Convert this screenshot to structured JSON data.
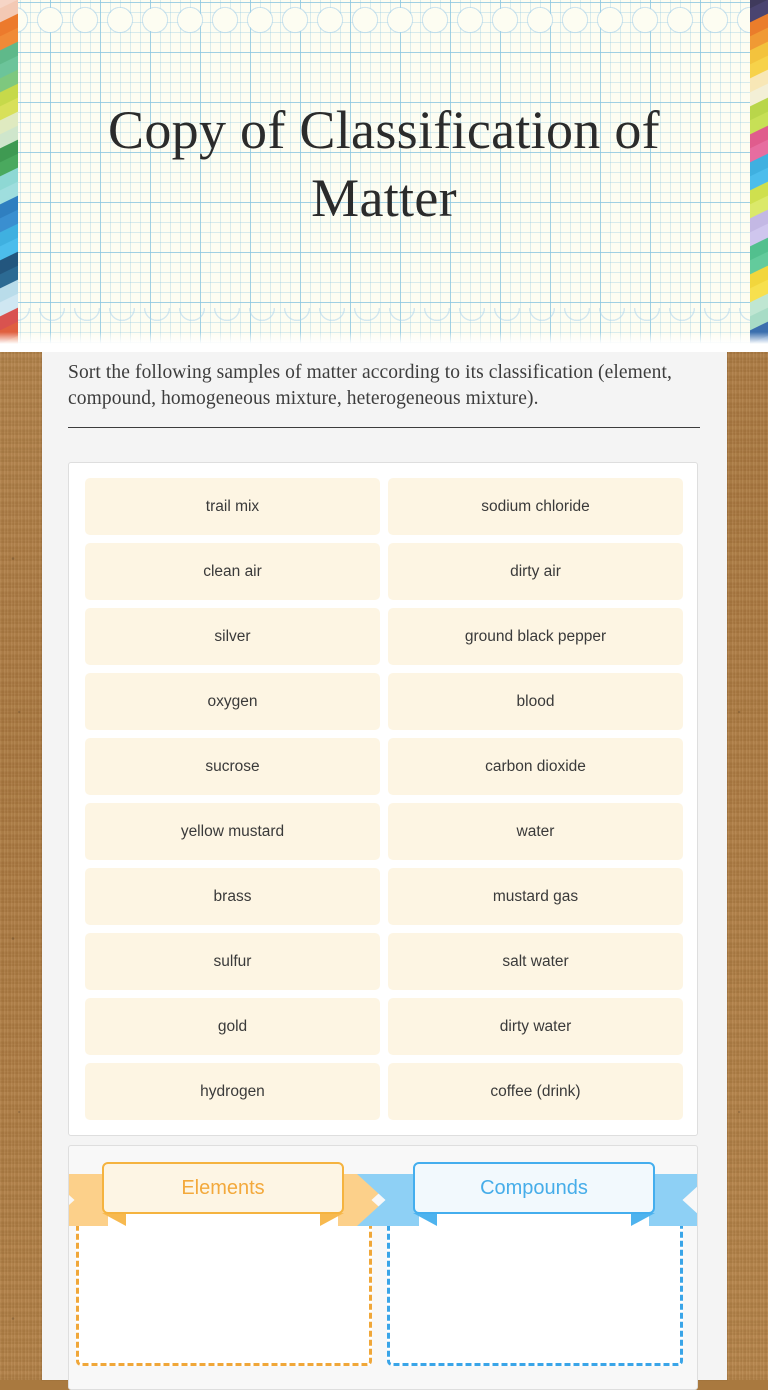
{
  "page": {
    "title": "Copy of Classification of Matter",
    "instruction": "Sort the following samples of matter according to its classification (element, compound, homogeneous mixture, heterogeneous mixture)."
  },
  "tiles": [
    {
      "label": "trail mix"
    },
    {
      "label": "sodium chloride"
    },
    {
      "label": "clean air"
    },
    {
      "label": "dirty air"
    },
    {
      "label": "silver"
    },
    {
      "label": "ground black pepper"
    },
    {
      "label": "oxygen"
    },
    {
      "label": "blood"
    },
    {
      "label": "sucrose"
    },
    {
      "label": "carbon dioxide"
    },
    {
      "label": "yellow mustard"
    },
    {
      "label": "water"
    },
    {
      "label": "brass"
    },
    {
      "label": "mustard gas"
    },
    {
      "label": "sulfur"
    },
    {
      "label": "salt water"
    },
    {
      "label": "gold"
    },
    {
      "label": "dirty water"
    },
    {
      "label": "hydrogen"
    },
    {
      "label": "coffee (drink)"
    }
  ],
  "categories": [
    {
      "label": "Elements",
      "accent": "#f3a93c",
      "dropzone_items": []
    },
    {
      "label": "Compounds",
      "accent": "#46ade9",
      "dropzone_items": []
    }
  ],
  "colors": {
    "tile_bg": "#fdf5e3",
    "tile_text": "#3a3a3a",
    "sheet_bg": "#f4f4f4",
    "card_bg": "#ffffff",
    "card_border": "#dedede",
    "backdrop_kraft": "#b07d45",
    "grid_paper": "#fdfdf2",
    "grid_line": "#89c4e0",
    "elements_accent": "#f3a93c",
    "compounds_accent": "#46ade9"
  },
  "crayon_stripes": {
    "left": [
      "#f6d5c6",
      "#f3c9b4",
      "#ec7a2c",
      "#f08a37",
      "#5fb98a",
      "#6cc49a",
      "#7ec87e",
      "#c6d94a",
      "#d8e05a",
      "#dfeac0",
      "#cfe6cc",
      "#3f9a52",
      "#4aa95e",
      "#8ed8d4",
      "#9fdede",
      "#2f7fc0",
      "#3a8fd0",
      "#3fb0e0",
      "#4cbdec",
      "#23567e",
      "#2c6a93",
      "#b9dcea",
      "#cfe7f2",
      "#d9534f",
      "#e0603f",
      "#e8764a"
    ],
    "right": [
      "#3f3a5c",
      "#4a4470",
      "#ea7d2b",
      "#f09a34",
      "#f3c33d",
      "#f7d24a",
      "#f8e7b6",
      "#f3efd6",
      "#b9d64a",
      "#c7e056",
      "#e05c8d",
      "#e76da0",
      "#3fb0e0",
      "#4cbdec",
      "#cfe04e",
      "#dbe96a",
      "#c3b8e4",
      "#cfc6ee",
      "#52c08e",
      "#63cb9c",
      "#f2d63c",
      "#f7e04e",
      "#bfe6d2",
      "#a8dcc6",
      "#3b6fae",
      "#4a7ebd"
    ]
  }
}
